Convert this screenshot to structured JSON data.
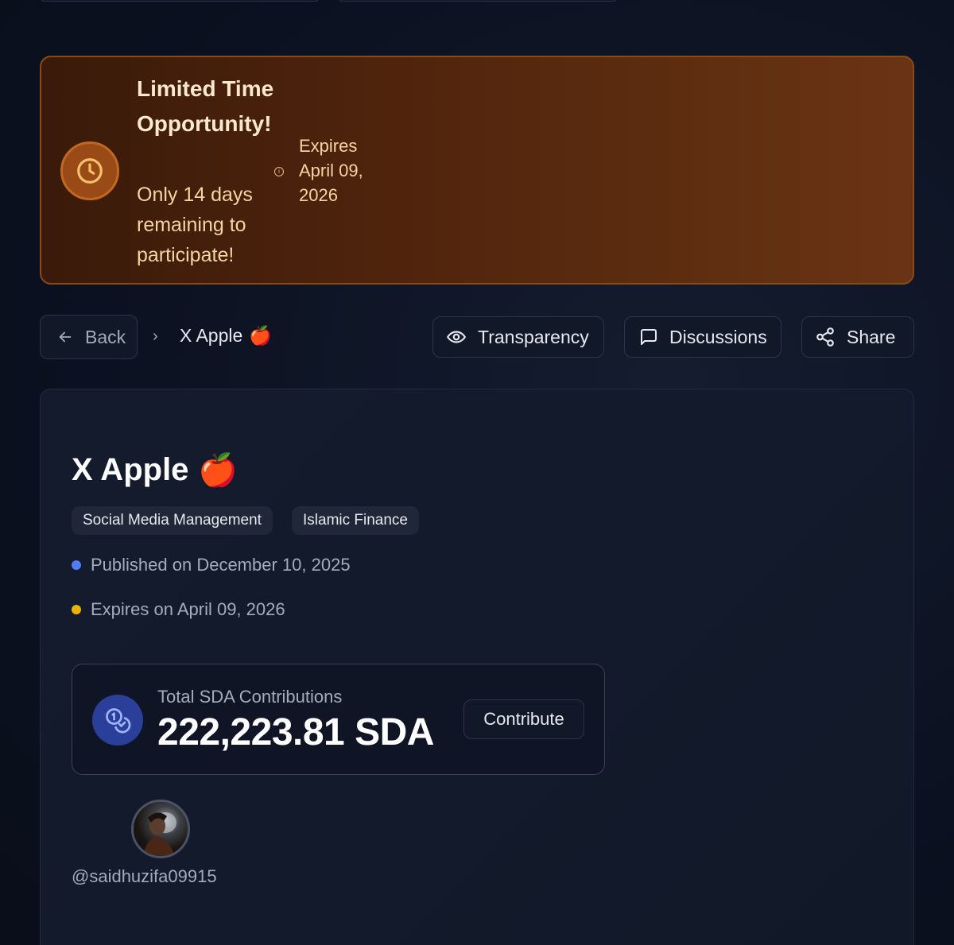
{
  "banner": {
    "title": "Limited Time Opportunity!",
    "subtitle": "Only 14 days remaining to participate!",
    "expires": "Expires April 09, 2026",
    "info_glyph": "i",
    "icon": "clock-icon",
    "colors": {
      "accent": "#c06820",
      "text": "#f7d3a3"
    }
  },
  "nav": {
    "back_label": "Back",
    "breadcrumb_sep": "›",
    "breadcrumb_current": "X Apple",
    "breadcrumb_emoji": "🍎",
    "transparency_label": "Transparency",
    "discussions_label": "Discussions",
    "share_label": "Share"
  },
  "project": {
    "title": "X Apple",
    "title_emoji": "🍎",
    "tags": [
      "Social Media Management",
      "Islamic Finance"
    ],
    "published": "Published on December 10, 2025",
    "expires": "Expires on April 09, 2026",
    "colors": {
      "published_dot": "#4f7df3",
      "expires_dot": "#eab308"
    }
  },
  "contributions": {
    "label": "Total SDA Contributions",
    "value": "222,223.81 SDA",
    "button_label": "Contribute",
    "icon": "coins-icon"
  },
  "author": {
    "username": "@saidhuzifa09915"
  }
}
